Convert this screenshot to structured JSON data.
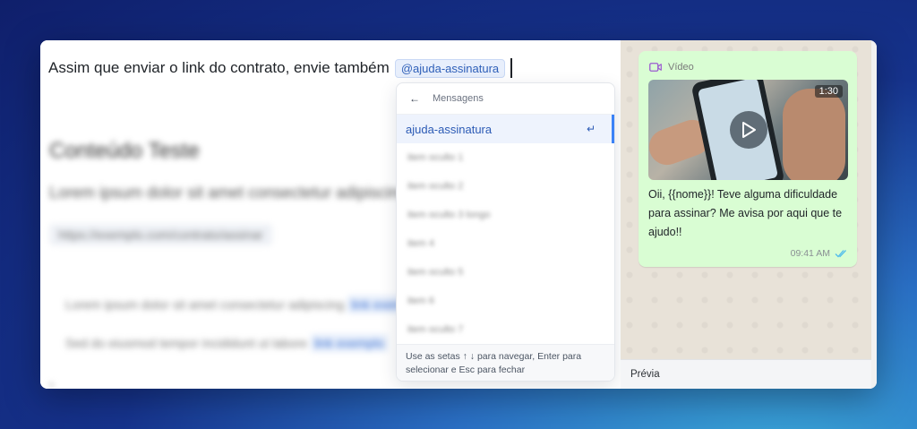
{
  "editor": {
    "line_text": "Assim que enviar o link do contrato, envie também",
    "mention": "@ajuda-assinatura",
    "blurred": {
      "heading": "Conteúdo Teste",
      "subheading": "Lorem ipsum dolor sit amet consectetur adipiscing elit",
      "link_row": "https://exemplo.com/contrato/assinar",
      "para1": "Lorem ipsum dolor sit amet consectetur adipiscing",
      "para1_link": "link exemplo",
      "para2": "Sed do eiusmod tempor incididunt ut labore",
      "para2_link": "link exemplo",
      "bullet": "•"
    }
  },
  "dropdown": {
    "back_icon": "←",
    "header": "Mensagens",
    "active_item": "ajuda-assinatura",
    "enter_icon": "↵",
    "items": [
      "item oculto 1",
      "item oculto 2",
      "item oculto 3 longo",
      "item 4",
      "item oculto 5",
      "item 6",
      "item oculto 7"
    ],
    "footer": "Use as setas ↑ ↓ para navegar, Enter para selecionar e Esc para fechar"
  },
  "preview": {
    "bubble": {
      "type_label": "Vídeo",
      "duration": "1:30",
      "text": "Oii, {{nome}}! Teve alguma dificuldade para assinar? Me avisa por aqui que te ajudo!!",
      "time": "09:41 AM"
    },
    "footer_label": "Prévia"
  },
  "colors": {
    "accent": "#3b82f6",
    "bubble_bg": "#d9fdd3",
    "mention_bg": "#e8effc",
    "video_icon": "#9b59d0",
    "read_ticks": "#53bdeb"
  }
}
